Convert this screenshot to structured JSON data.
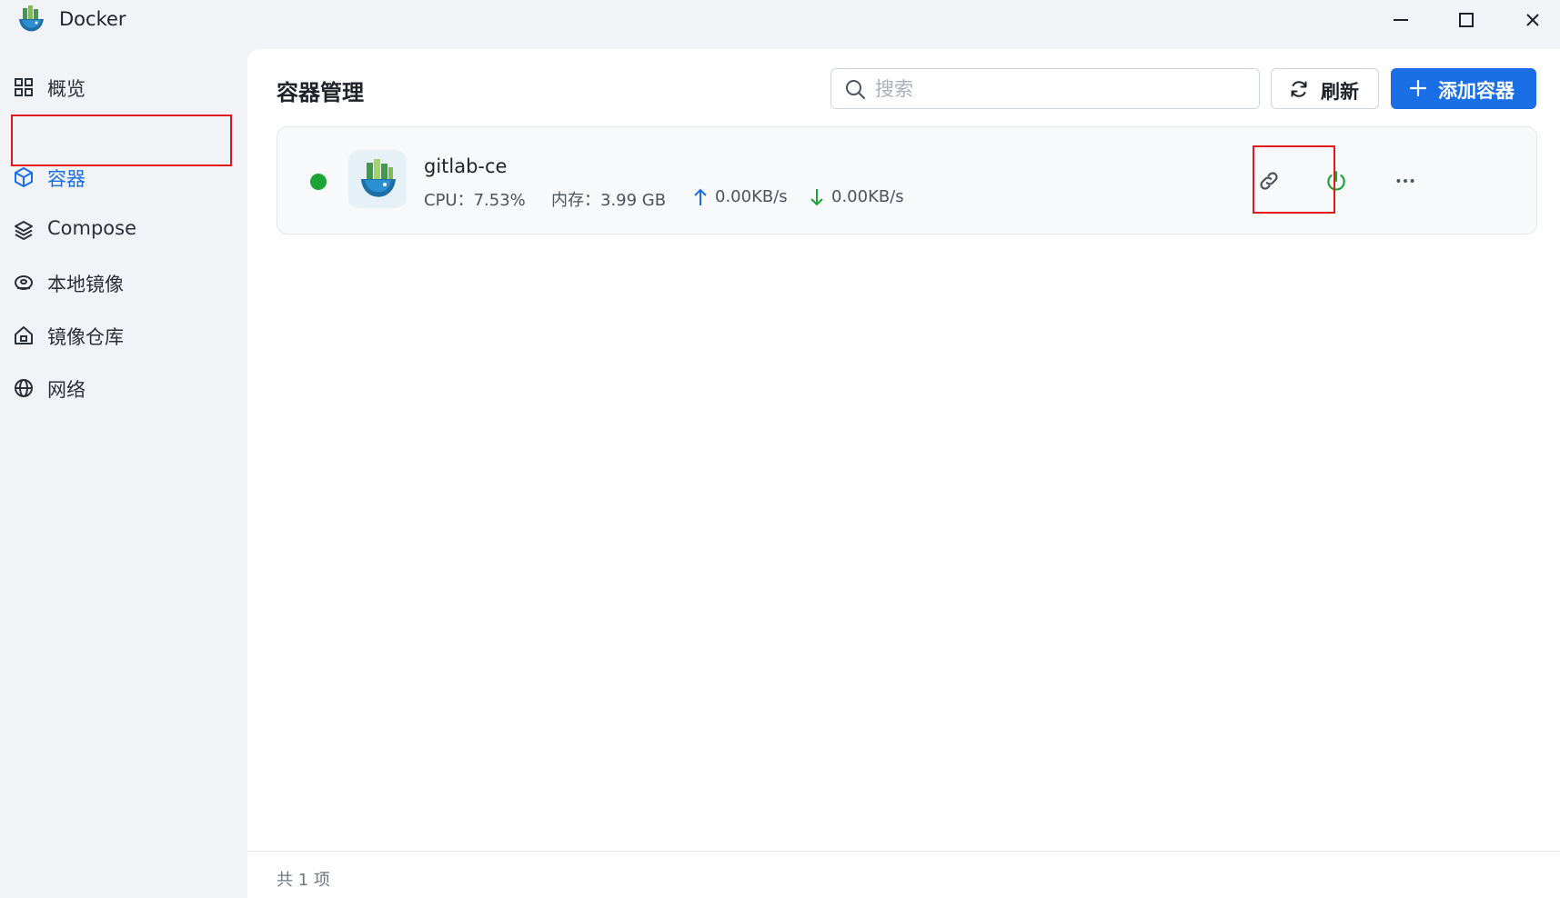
{
  "app": {
    "title": "Docker"
  },
  "window_controls": {
    "minimize": "minimize",
    "maximize": "maximize",
    "close": "close"
  },
  "sidebar": {
    "items": [
      {
        "label": "概览",
        "icon": "grid-icon",
        "active": false
      },
      {
        "label": "容器",
        "icon": "cube-icon",
        "active": true
      },
      {
        "label": "Compose",
        "icon": "layers-icon",
        "active": false
      },
      {
        "label": "本地镜像",
        "icon": "disk-icon",
        "active": false
      },
      {
        "label": "镜像仓库",
        "icon": "home-icon",
        "active": false
      },
      {
        "label": "网络",
        "icon": "globe-icon",
        "active": false
      }
    ]
  },
  "main": {
    "title": "容器管理",
    "search": {
      "placeholder": "搜索",
      "value": ""
    },
    "refresh_label": "刷新",
    "add_label": "添加容器",
    "containers": [
      {
        "name": "gitlab-ce",
        "status": "running",
        "cpu": "CPU：7.53%",
        "memory": "内存：3.99 GB",
        "upload": "0.00KB/s",
        "download": "0.00KB/s"
      }
    ],
    "footer_count": "共 1 项"
  },
  "colors": {
    "accent": "#1a6ee6",
    "running": "#1aa535",
    "highlight": "#e0171b",
    "power": "#1aa535"
  }
}
